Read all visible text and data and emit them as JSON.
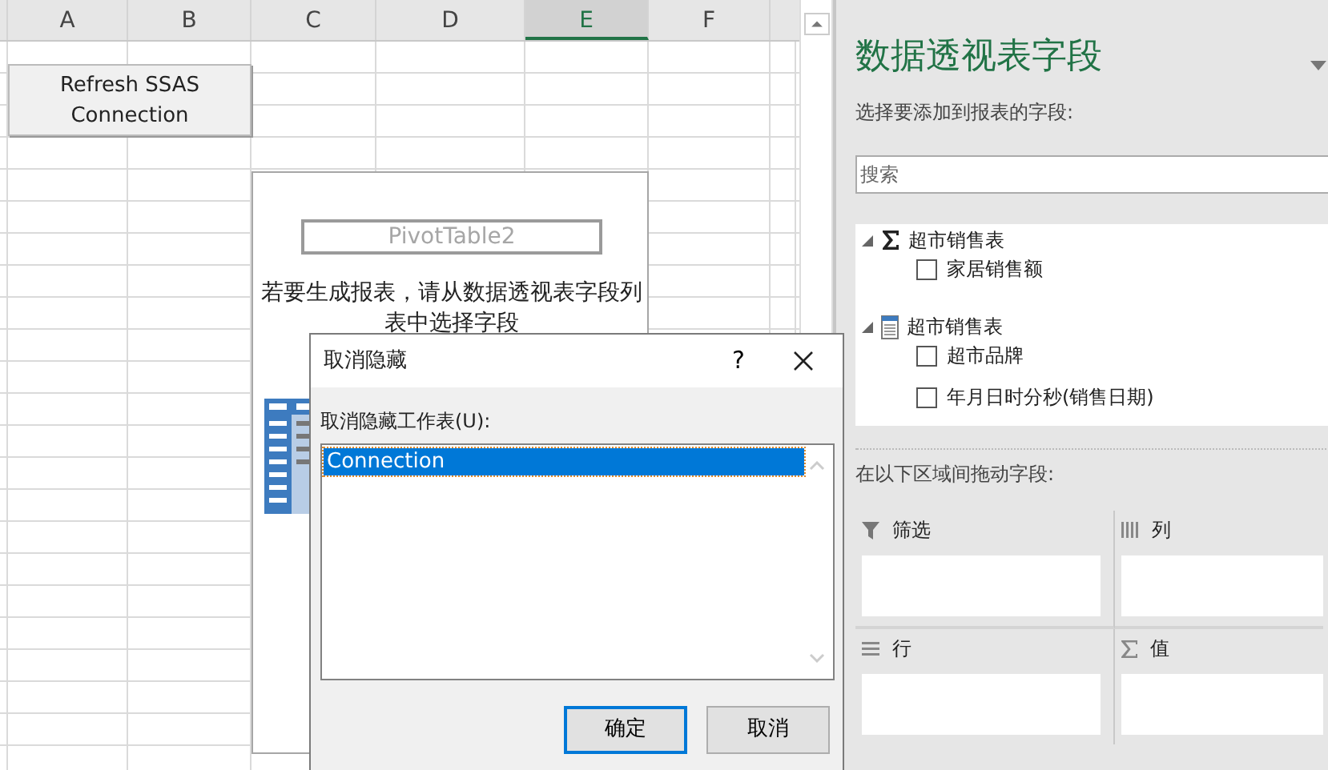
{
  "columns": [
    {
      "label": "A",
      "selected": false
    },
    {
      "label": "B",
      "selected": false
    },
    {
      "label": "C",
      "selected": false
    },
    {
      "label": "D",
      "selected": false
    },
    {
      "label": "E",
      "selected": true
    },
    {
      "label": "F",
      "selected": false
    }
  ],
  "sheet_button": {
    "label": "Refresh SSAS Connection"
  },
  "pivot_placeholder": {
    "name": "PivotTable2",
    "hint": "若要生成报表，请从数据透视表字段列表中选择字段"
  },
  "field_panel": {
    "title": "数据透视表字段",
    "subtitle": "选择要添加到报表的字段:",
    "search": {
      "placeholder": "搜索"
    },
    "tables": [
      {
        "kind": "measure",
        "name": "超市销售表",
        "expanded": true,
        "fields": [
          {
            "label": "家居销售额",
            "checked": false
          }
        ]
      },
      {
        "kind": "table",
        "name": "超市销售表",
        "expanded": true,
        "fields": [
          {
            "label": "超市品牌",
            "checked": false
          },
          {
            "label": "年月日时分秒(销售日期)",
            "checked": false
          }
        ]
      }
    ],
    "areas_label": "在以下区域间拖动字段:",
    "areas": [
      {
        "kind": "filter",
        "label": "筛选"
      },
      {
        "kind": "columns",
        "label": "列"
      },
      {
        "kind": "rows",
        "label": "行"
      },
      {
        "kind": "values",
        "label": "值"
      }
    ]
  },
  "dialog": {
    "title": "取消隐藏",
    "help": "?",
    "list_label": "取消隐藏工作表(U):",
    "items": [
      {
        "label": "Connection",
        "selected": true
      }
    ],
    "buttons": [
      {
        "label": "确定",
        "default": true
      },
      {
        "label": "取消",
        "default": false
      }
    ]
  }
}
